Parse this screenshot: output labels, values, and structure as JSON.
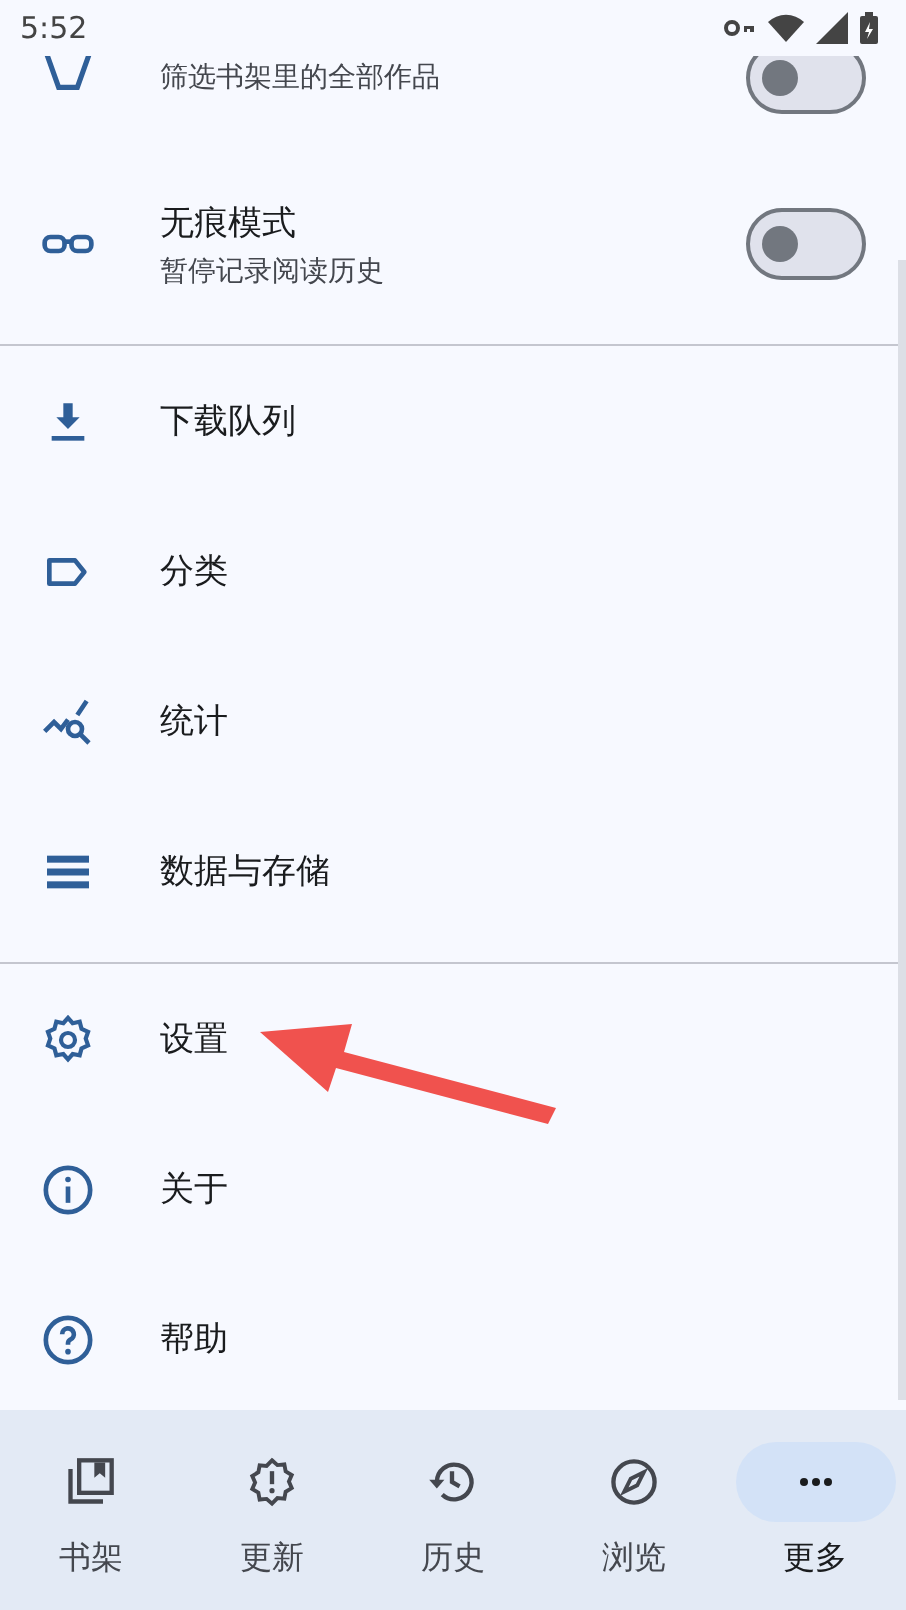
{
  "status_bar": {
    "time": "5:52"
  },
  "toggles": [
    {
      "kind": "filter",
      "subtitle": "筛选书架里的全部作品",
      "on": false
    },
    {
      "kind": "incognito",
      "title": "无痕模式",
      "subtitle": "暂停记录阅读历史",
      "on": false
    }
  ],
  "menu_groups": [
    [
      {
        "kind": "download",
        "label": "下载队列"
      },
      {
        "kind": "label",
        "label": "分类"
      },
      {
        "kind": "stats",
        "label": "统计"
      },
      {
        "kind": "storage",
        "label": "数据与存储"
      }
    ],
    [
      {
        "kind": "settings",
        "label": "设置"
      },
      {
        "kind": "info",
        "label": "关于"
      },
      {
        "kind": "help",
        "label": "帮助"
      }
    ]
  ],
  "bottom_nav": [
    {
      "kind": "library",
      "label": "书架",
      "selected": false
    },
    {
      "kind": "updates",
      "label": "更新",
      "selected": false
    },
    {
      "kind": "history",
      "label": "历史",
      "selected": false
    },
    {
      "kind": "browse",
      "label": "浏览",
      "selected": false
    },
    {
      "kind": "more",
      "label": "更多",
      "selected": true
    }
  ]
}
